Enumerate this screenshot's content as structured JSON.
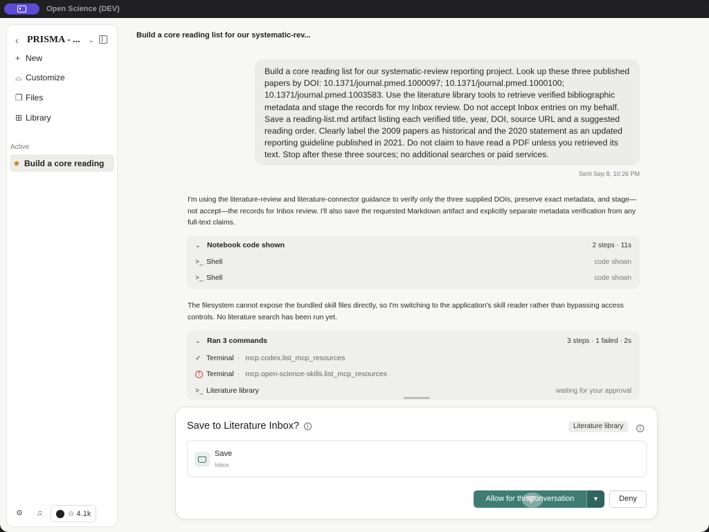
{
  "app": {
    "title": "Open Science (DEV)"
  },
  "sidebar": {
    "project": "PRISMA - ...",
    "nav": [
      {
        "label": "New",
        "icon": "plus-icon"
      },
      {
        "label": "Customize",
        "icon": "customize-icon"
      },
      {
        "label": "Files",
        "icon": "files-icon"
      },
      {
        "label": "Library",
        "icon": "book-icon"
      }
    ],
    "section_label": "Active",
    "active_item": "Build a core reading list",
    "github_stars": "4.1k"
  },
  "conversation": {
    "title": "Build a core reading list for our systematic-rev...",
    "user_message": "Build a core reading list for our systematic-review reporting project. Look up these three published papers by DOI: 10.1371/journal.pmed.1000097; 10.1371/journal.pmed.1000100; 10.1371/journal.pmed.1003583. Use the literature library tools to retrieve verified bibliographic metadata and stage the records for my Inbox review. Do not accept Inbox entries on my behalf. Save a reading-list.md artifact listing each verified title, year, DOI, source URL and a suggested reading order. Clearly label the 2009 papers as historical and the 2020 statement as an updated reporting guideline published in 2021. Do not claim to have read a PDF unless you retrieved its text. Stop after these three sources; no additional searches or paid services.",
    "sent": "Sent Sep 8, 10:26 PM",
    "assistant_1": "I'm using the literature-review and literature-connector guidance to verify only the three supplied DOIs, preserve exact metadata, and stage—not accept—the records for Inbox review. I'll also save the requested Markdown artifact and explicitly separate metadata verification from any full-text claims.",
    "card_1": {
      "title": "Notebook code shown",
      "meta": "2 steps · 11s",
      "rows": [
        {
          "label": "Shell",
          "status": "code shown"
        },
        {
          "label": "Shell",
          "status": "code shown"
        }
      ]
    },
    "assistant_2": "The filesystem cannot expose the bundled skill files directly, so I'm switching to the application's skill reader rather than bypassing access controls. No literature search has been run yet.",
    "card_2": {
      "title": "Ran 3 commands",
      "meta": "3 steps · 1 failed · 2s",
      "rows": [
        {
          "label": "Terminal",
          "sep": "·",
          "command": "mcp.codex.list_mcp_resources",
          "status": ""
        },
        {
          "label": "Terminal",
          "sep": "·",
          "command": "mcp.open-science-skills.list_mcp_resources",
          "status": ""
        },
        {
          "label": "Literature library",
          "sep": "",
          "command": "",
          "status": "waiting for your approval"
        }
      ]
    }
  },
  "approval": {
    "title": "Save to Literature Inbox?",
    "badge": "Literature library",
    "item_title": "Save",
    "item_subtitle": "Inbox",
    "allow_label": "Allow for this conversation",
    "deny_label": "Deny"
  },
  "colors": {
    "accent": "#3f7d74",
    "pill": "#5d4bd6",
    "status_dot": "#c48a2d",
    "error": "#cc4444"
  }
}
